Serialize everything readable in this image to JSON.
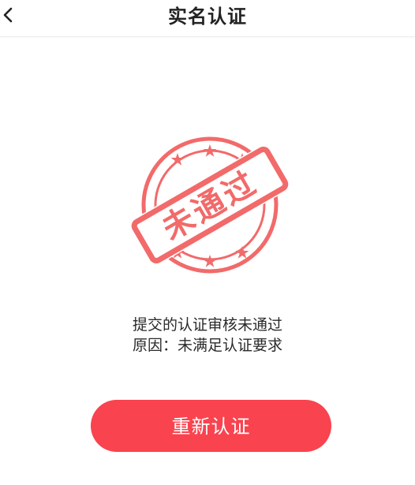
{
  "header": {
    "title": "实名认证",
    "back_icon": "chevron-left-icon"
  },
  "stamp": {
    "text": "未通过",
    "color": "#f26a6a",
    "icon": "rejected-stamp-icon"
  },
  "message": {
    "line1": "提交的认证审核未通过",
    "line2": "原因：未满足认证要求"
  },
  "actions": {
    "retry_label": "重新认证",
    "retry_color": "#f9434f"
  }
}
